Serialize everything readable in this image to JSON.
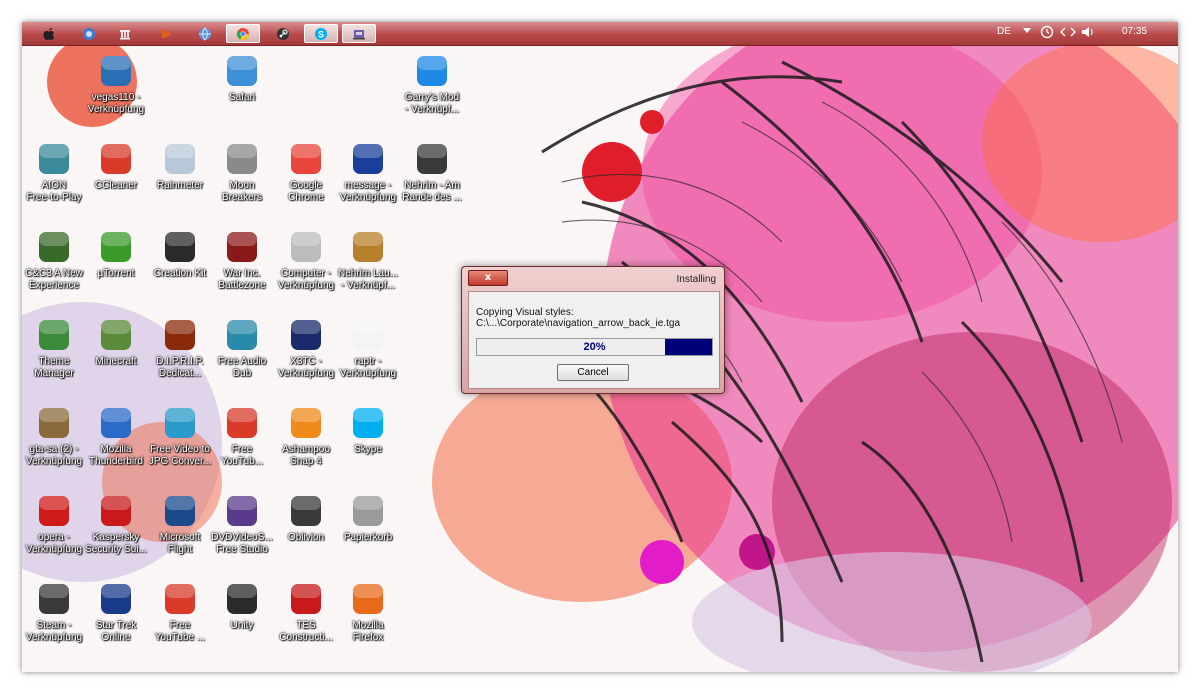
{
  "taskbar": {
    "language": "DE",
    "clock": "07:35",
    "buttons": [
      {
        "name": "apple-menu-icon",
        "color": "#222222"
      },
      {
        "name": "itunes-icon",
        "color": "#3c7bd6"
      },
      {
        "name": "library-icon",
        "color": "#cfcfcf"
      },
      {
        "name": "media-player-icon",
        "color": "#e06020"
      },
      {
        "name": "globe-icon",
        "color": "#5b8fd8"
      },
      {
        "name": "chrome-icon",
        "color": "#e8453c"
      },
      {
        "name": "steam-icon",
        "color": "#333333"
      },
      {
        "name": "skype-icon",
        "color": "#00aff0"
      },
      {
        "name": "installer-icon",
        "color": "#6b5ea8"
      }
    ]
  },
  "desktop": {
    "icons": [
      {
        "label": "vegas110 -\nVerknüpfung",
        "icon": "vegas-icon",
        "color": "#2a6fb5"
      },
      {
        "label": "Safari",
        "icon": "safari-icon",
        "color": "#3d8fd8"
      },
      {
        "label": "Garry's Mod\n- Verknüpf...",
        "icon": "garrys-mod-icon",
        "color": "#1e88e5"
      },
      {
        "label": "AION\nFree-to-Play",
        "icon": "aion-icon",
        "color": "#3a8a9a"
      },
      {
        "label": "CCleaner",
        "icon": "ccleaner-icon",
        "color": "#d93a2a"
      },
      {
        "label": "Rainmeter",
        "icon": "rainmeter-icon",
        "color": "#b8c8d8"
      },
      {
        "label": "Moon\nBreakers",
        "icon": "moon-breakers-icon",
        "color": "#8a8a8a"
      },
      {
        "label": "Google\nChrome",
        "icon": "chrome-icon",
        "color": "#e8453c"
      },
      {
        "label": "message -\nVerknüpfung",
        "icon": "info-icon",
        "color": "#1a3f9a"
      },
      {
        "label": "Nehrim - Am\nRande des ...",
        "icon": "nehrim-icon",
        "color": "#3a3a3a"
      },
      {
        "label": "C&C3 A New\nExperience",
        "icon": "cnc3-icon",
        "color": "#3a6a2a"
      },
      {
        "label": "µTorrent",
        "icon": "utorrent-icon",
        "color": "#3a9a2a"
      },
      {
        "label": "Creation Kit",
        "icon": "creation-kit-icon",
        "color": "#2a2a2a"
      },
      {
        "label": "War Inc.\nBattlezone",
        "icon": "war-inc-icon",
        "color": "#8a1a1a"
      },
      {
        "label": "Computer -\nVerknüpfung",
        "icon": "computer-icon",
        "color": "#bcbcbc"
      },
      {
        "label": "Nehrim Lau...\n- Verknüpf...",
        "icon": "nehrim-launcher-icon",
        "color": "#b8802a"
      },
      {
        "label": "Theme\nManager",
        "icon": "theme-manager-icon",
        "color": "#3a8a3a"
      },
      {
        "label": "Minecraft",
        "icon": "minecraft-icon",
        "color": "#5a8a3a"
      },
      {
        "label": "D.I.P.R.I.P.\nDedicat...",
        "icon": "diprip-icon",
        "color": "#8a2a0a"
      },
      {
        "label": "Free Audio\nDub",
        "icon": "free-audio-dub-icon",
        "color": "#2a8aaa"
      },
      {
        "label": "X3TC -\nVerknüpfung",
        "icon": "x3tc-icon",
        "color": "#1a2a6a"
      },
      {
        "label": "raptr -\nVerknüpfung",
        "icon": "blank-file-icon",
        "color": "#f4f4f4"
      },
      {
        "label": "gta-sa (2) -\nVerknüpfung",
        "icon": "gta-sa-icon",
        "color": "#8a6a3a"
      },
      {
        "label": "Mozilla\nThunderbird",
        "icon": "thunderbird-icon",
        "color": "#2a6ac8"
      },
      {
        "label": "Free Video to\nJPG Conver...",
        "icon": "video-to-jpg-icon",
        "color": "#2a9ac8"
      },
      {
        "label": "Free\nYouTub...",
        "icon": "youtube-download-icon",
        "color": "#d93a2a"
      },
      {
        "label": "Ashampoo\nSnap 4",
        "icon": "ashampoo-snap-icon",
        "color": "#f08a1a"
      },
      {
        "label": "Skype",
        "icon": "skype-icon",
        "color": "#00aff0"
      },
      {
        "label": "opera -\nVerknüpfung",
        "icon": "opera-icon",
        "color": "#d01a1a"
      },
      {
        "label": "Kaspersky\nSecurity Sui...",
        "icon": "kaspersky-icon",
        "color": "#c81a1a"
      },
      {
        "label": "Microsoft\nFlight",
        "icon": "microsoft-flight-icon",
        "color": "#1a4a8a"
      },
      {
        "label": "DVDVideoS...\nFree Studio",
        "icon": "dvdvideosoft-icon",
        "color": "#5a3a8a"
      },
      {
        "label": "Oblivion",
        "icon": "oblivion-icon",
        "color": "#3a3a3a"
      },
      {
        "label": "Papierkorb",
        "icon": "recycle-bin-icon",
        "color": "#9a9a9a"
      },
      {
        "label": "Steam -\nVerknüpfung",
        "icon": "steam-icon",
        "color": "#3a3a3a"
      },
      {
        "label": "Star Trek\nOnline",
        "icon": "star-trek-icon",
        "color": "#1a3a8a"
      },
      {
        "label": "Free\nYouTube ...",
        "icon": "youtube-mp3-icon",
        "color": "#d93a2a"
      },
      {
        "label": "Unity",
        "icon": "unity-icon",
        "color": "#2a2a2a"
      },
      {
        "label": "TES\nConstructi...",
        "icon": "tes-construction-icon",
        "color": "#c81a1a"
      },
      {
        "label": "Mozilla\nFirefox",
        "icon": "firefox-icon",
        "color": "#e86a1a"
      }
    ]
  },
  "dialog": {
    "title": "Installing",
    "close_label": "x",
    "message_line1": "Copying Visual styles:",
    "message_line2": "C:\\...\\Corporate\\navigation_arrow_back_ie.tga",
    "progress_percent": 20,
    "progress_text": "20%",
    "cancel_label": "Cancel",
    "progress_color": "#000078"
  }
}
